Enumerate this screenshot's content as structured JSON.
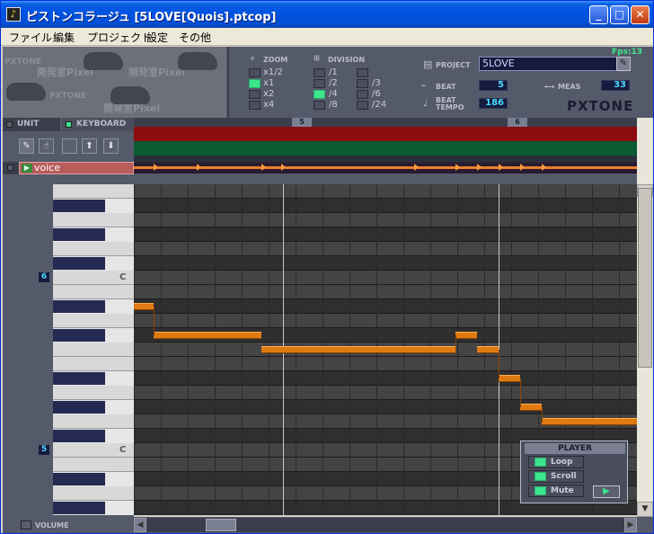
{
  "window": {
    "title": "ピストンコラージュ [5LOVE[Quois].ptcop]"
  },
  "menu": [
    "ファイル",
    "編集",
    "プロジェクト",
    "設定",
    "その他"
  ],
  "fps": "Fps:13",
  "zoom": {
    "label": "ZOOM",
    "options": [
      "x1/2",
      "x1",
      "x2",
      "x4"
    ],
    "selected": "x1"
  },
  "division": {
    "label": "DIVISION",
    "options": [
      "/1",
      "/2",
      "/4",
      "/8",
      "/3",
      "/6",
      "/24"
    ],
    "selected": "/4"
  },
  "project": {
    "label": "PROJECT",
    "name": "5LOVE"
  },
  "beat": {
    "label": "BEAT",
    "value": "5"
  },
  "meas": {
    "label": "MEAS",
    "value": "33"
  },
  "tempo": {
    "label": "BEAT TEMPO",
    "value": "186"
  },
  "brand": "PXTONE",
  "tabs": {
    "unit": "UNIT",
    "keyboard": "KEYBOARD"
  },
  "tools": {
    "pen": "✎",
    "hand": "☝",
    "up": "⬆",
    "down": "⬇"
  },
  "unit_name": "voice",
  "measures": [
    "5",
    "6"
  ],
  "octaves": [
    {
      "num": "6",
      "note": "C"
    },
    {
      "num": "5",
      "note": "C"
    }
  ],
  "player": {
    "title": "PLAYER",
    "loop": "Loop",
    "scroll": "Scroll",
    "mute": "Mute",
    "play": "▶"
  },
  "volume": "VOLUME",
  "logo_text": "PXTONE",
  "logo_jp": "開発室Pixel",
  "title_buttons": {
    "min": "_",
    "max": "□",
    "close": "✕"
  }
}
